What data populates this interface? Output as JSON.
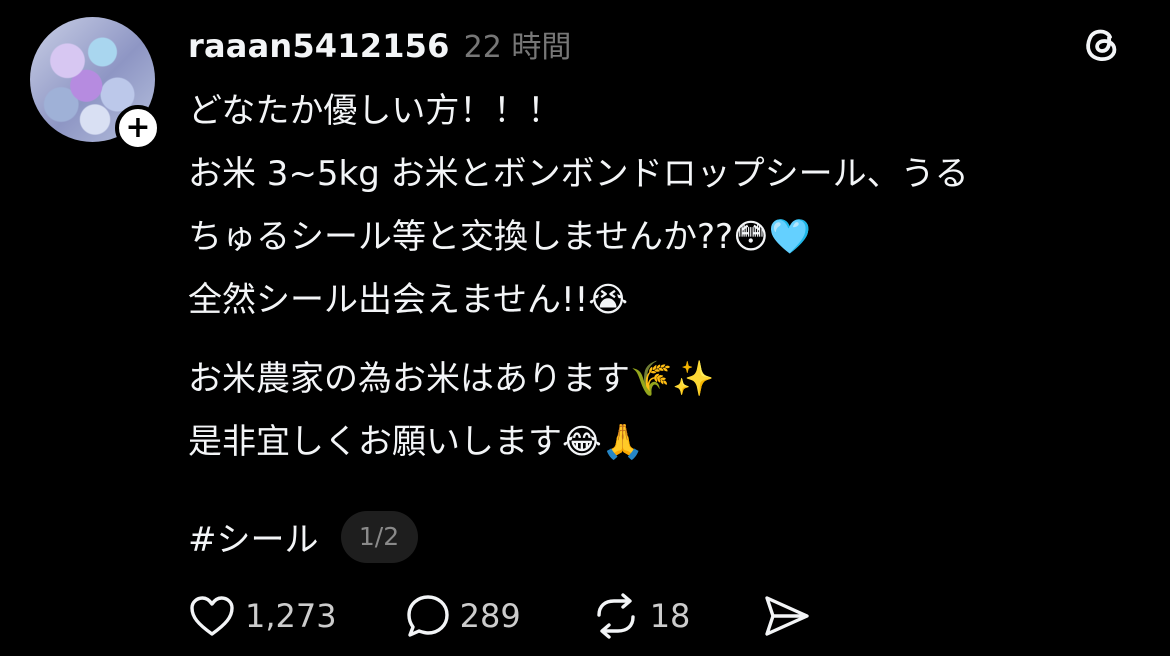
{
  "post": {
    "username": "raaan5412156",
    "time": "22 時間",
    "lines": [
      "どなたか優しい方！！！",
      "お米 3~5kg お米とボンボンドロップシール、うる",
      "ちゅるシール等と交換しませんか??😳🩵",
      "全然シール出会えません!!😭",
      "お米農家の為お米はあります🌾✨",
      "是非宜しくお願いします😂🙏"
    ],
    "hashtag": "#シール",
    "page_indicator": "1/2"
  },
  "actions": {
    "likes": "1,273",
    "replies": "289",
    "reposts": "18"
  },
  "icons": [
    "follow-plus-icon",
    "threads-logo-icon",
    "heart-icon",
    "comment-icon",
    "repost-icon",
    "share-icon"
  ]
}
